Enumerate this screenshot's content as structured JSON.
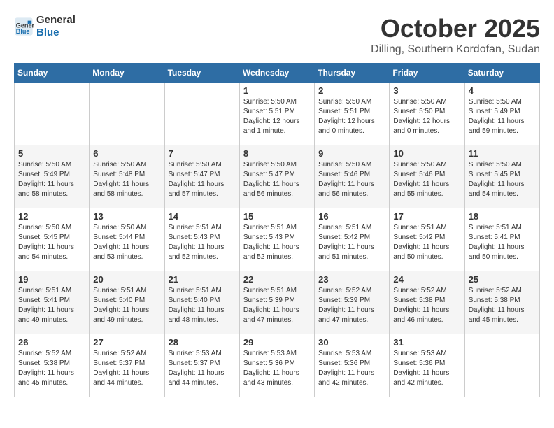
{
  "header": {
    "logo_line1": "General",
    "logo_line2": "Blue",
    "month": "October 2025",
    "location": "Dilling, Southern Kordofan, Sudan"
  },
  "weekdays": [
    "Sunday",
    "Monday",
    "Tuesday",
    "Wednesday",
    "Thursday",
    "Friday",
    "Saturday"
  ],
  "weeks": [
    [
      {
        "day": "",
        "info": ""
      },
      {
        "day": "",
        "info": ""
      },
      {
        "day": "",
        "info": ""
      },
      {
        "day": "1",
        "info": "Sunrise: 5:50 AM\nSunset: 5:51 PM\nDaylight: 12 hours\nand 1 minute."
      },
      {
        "day": "2",
        "info": "Sunrise: 5:50 AM\nSunset: 5:51 PM\nDaylight: 12 hours\nand 0 minutes."
      },
      {
        "day": "3",
        "info": "Sunrise: 5:50 AM\nSunset: 5:50 PM\nDaylight: 12 hours\nand 0 minutes."
      },
      {
        "day": "4",
        "info": "Sunrise: 5:50 AM\nSunset: 5:49 PM\nDaylight: 11 hours\nand 59 minutes."
      }
    ],
    [
      {
        "day": "5",
        "info": "Sunrise: 5:50 AM\nSunset: 5:49 PM\nDaylight: 11 hours\nand 58 minutes."
      },
      {
        "day": "6",
        "info": "Sunrise: 5:50 AM\nSunset: 5:48 PM\nDaylight: 11 hours\nand 58 minutes."
      },
      {
        "day": "7",
        "info": "Sunrise: 5:50 AM\nSunset: 5:47 PM\nDaylight: 11 hours\nand 57 minutes."
      },
      {
        "day": "8",
        "info": "Sunrise: 5:50 AM\nSunset: 5:47 PM\nDaylight: 11 hours\nand 56 minutes."
      },
      {
        "day": "9",
        "info": "Sunrise: 5:50 AM\nSunset: 5:46 PM\nDaylight: 11 hours\nand 56 minutes."
      },
      {
        "day": "10",
        "info": "Sunrise: 5:50 AM\nSunset: 5:46 PM\nDaylight: 11 hours\nand 55 minutes."
      },
      {
        "day": "11",
        "info": "Sunrise: 5:50 AM\nSunset: 5:45 PM\nDaylight: 11 hours\nand 54 minutes."
      }
    ],
    [
      {
        "day": "12",
        "info": "Sunrise: 5:50 AM\nSunset: 5:45 PM\nDaylight: 11 hours\nand 54 minutes."
      },
      {
        "day": "13",
        "info": "Sunrise: 5:50 AM\nSunset: 5:44 PM\nDaylight: 11 hours\nand 53 minutes."
      },
      {
        "day": "14",
        "info": "Sunrise: 5:51 AM\nSunset: 5:43 PM\nDaylight: 11 hours\nand 52 minutes."
      },
      {
        "day": "15",
        "info": "Sunrise: 5:51 AM\nSunset: 5:43 PM\nDaylight: 11 hours\nand 52 minutes."
      },
      {
        "day": "16",
        "info": "Sunrise: 5:51 AM\nSunset: 5:42 PM\nDaylight: 11 hours\nand 51 minutes."
      },
      {
        "day": "17",
        "info": "Sunrise: 5:51 AM\nSunset: 5:42 PM\nDaylight: 11 hours\nand 50 minutes."
      },
      {
        "day": "18",
        "info": "Sunrise: 5:51 AM\nSunset: 5:41 PM\nDaylight: 11 hours\nand 50 minutes."
      }
    ],
    [
      {
        "day": "19",
        "info": "Sunrise: 5:51 AM\nSunset: 5:41 PM\nDaylight: 11 hours\nand 49 minutes."
      },
      {
        "day": "20",
        "info": "Sunrise: 5:51 AM\nSunset: 5:40 PM\nDaylight: 11 hours\nand 49 minutes."
      },
      {
        "day": "21",
        "info": "Sunrise: 5:51 AM\nSunset: 5:40 PM\nDaylight: 11 hours\nand 48 minutes."
      },
      {
        "day": "22",
        "info": "Sunrise: 5:51 AM\nSunset: 5:39 PM\nDaylight: 11 hours\nand 47 minutes."
      },
      {
        "day": "23",
        "info": "Sunrise: 5:52 AM\nSunset: 5:39 PM\nDaylight: 11 hours\nand 47 minutes."
      },
      {
        "day": "24",
        "info": "Sunrise: 5:52 AM\nSunset: 5:38 PM\nDaylight: 11 hours\nand 46 minutes."
      },
      {
        "day": "25",
        "info": "Sunrise: 5:52 AM\nSunset: 5:38 PM\nDaylight: 11 hours\nand 45 minutes."
      }
    ],
    [
      {
        "day": "26",
        "info": "Sunrise: 5:52 AM\nSunset: 5:38 PM\nDaylight: 11 hours\nand 45 minutes."
      },
      {
        "day": "27",
        "info": "Sunrise: 5:52 AM\nSunset: 5:37 PM\nDaylight: 11 hours\nand 44 minutes."
      },
      {
        "day": "28",
        "info": "Sunrise: 5:53 AM\nSunset: 5:37 PM\nDaylight: 11 hours\nand 44 minutes."
      },
      {
        "day": "29",
        "info": "Sunrise: 5:53 AM\nSunset: 5:36 PM\nDaylight: 11 hours\nand 43 minutes."
      },
      {
        "day": "30",
        "info": "Sunrise: 5:53 AM\nSunset: 5:36 PM\nDaylight: 11 hours\nand 42 minutes."
      },
      {
        "day": "31",
        "info": "Sunrise: 5:53 AM\nSunset: 5:36 PM\nDaylight: 11 hours\nand 42 minutes."
      },
      {
        "day": "",
        "info": ""
      }
    ]
  ]
}
